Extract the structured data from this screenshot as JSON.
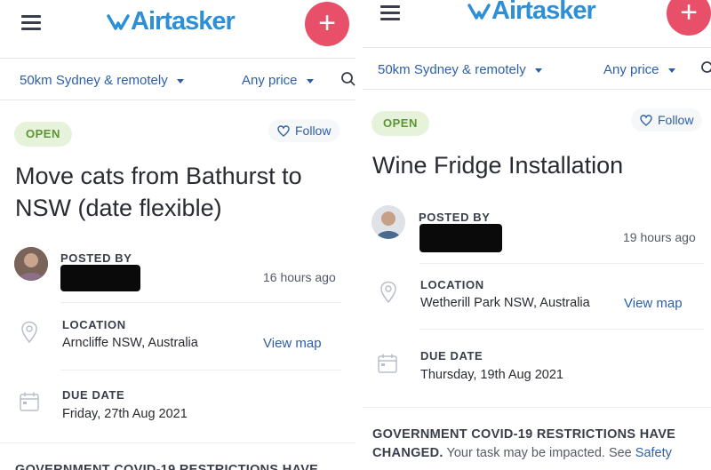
{
  "left": {
    "brand": "Airtasker",
    "add_label": "+",
    "filters": {
      "location": "50km Sydney & remotely",
      "price": "Any price"
    },
    "status": "OPEN",
    "follow_label": "Follow",
    "title": "Move cats from Bathurst to NSW (date flexible)",
    "posted_by_label": "POSTED BY",
    "posted_time": "16 hours ago",
    "location_label": "LOCATION",
    "location_value": "Arncliffe NSW, Australia",
    "view_map": "View map",
    "due_date_label": "DUE DATE",
    "due_date_value": "Friday, 27th Aug 2021",
    "notice_partial": "GOVERNMENT COVID-19 RESTRICTIONS HAVE"
  },
  "right": {
    "brand": "Airtasker",
    "add_label": "+",
    "filters": {
      "location": "50km Sydney & remotely",
      "price": "Any price"
    },
    "status": "OPEN",
    "follow_label": "Follow",
    "title": "Wine Fridge Installation",
    "posted_by_label": "POSTED BY",
    "posted_time": "19 hours ago",
    "location_label": "LOCATION",
    "location_value": "Wetherill Park NSW, Australia",
    "view_map": "View map",
    "due_date_label": "DUE DATE",
    "due_date_value": "Thursday, 19th Aug 2021",
    "notice_heading_1": "GOVERNMENT COVID-19 RESTRICTIONS HAVE",
    "notice_heading_2": "CHANGED.",
    "notice_text": "Your task may be impacted. See",
    "notice_link": "Safety"
  },
  "colors": {
    "brand_blue": "#2d8fd5",
    "add_pink": "#e8506a",
    "link_blue": "#2d5fa8",
    "open_green": "#5c9434"
  },
  "icons": [
    "hamburger-icon",
    "logo-icon",
    "plus-icon",
    "search-icon",
    "heart-icon",
    "location-pin-icon",
    "calendar-icon"
  ]
}
